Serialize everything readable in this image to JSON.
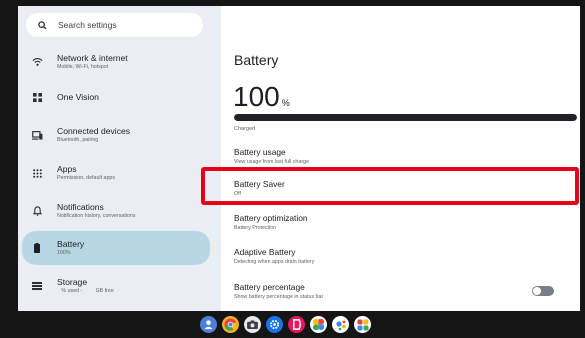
{
  "search": {
    "placeholder": "Search settings"
  },
  "sidebar": {
    "items": [
      {
        "title": "Network & internet",
        "subtitle": "Mobile, Wi-Fi, hotspot",
        "icon": "wifi-icon"
      },
      {
        "title": "One Vision",
        "subtitle": "",
        "icon": "grid-icon"
      },
      {
        "title": "Connected devices",
        "subtitle": "Bluetooth, pairing",
        "icon": "devices-icon"
      },
      {
        "title": "Apps",
        "subtitle": "Permission, default apps",
        "icon": "apps-icon"
      },
      {
        "title": "Notifications",
        "subtitle": "Notification history, conversations",
        "icon": "bell-icon"
      },
      {
        "title": "Battery",
        "subtitle": "100%",
        "icon": "battery-icon",
        "active": true
      },
      {
        "title": "Storage",
        "subtitle": "   % used -         GB free",
        "icon": "storage-icon"
      }
    ]
  },
  "main": {
    "title": "Battery",
    "percent": "100",
    "percent_unit": "%",
    "level": 1.0,
    "status": "Charged",
    "rows": [
      {
        "title": "Battery usage",
        "subtitle": "View usage from last full charge"
      },
      {
        "title": "Battery Saver",
        "subtitle": "Off"
      },
      {
        "title": "Battery optimization",
        "subtitle": "Battery Protection"
      },
      {
        "title": "Adaptive Battery",
        "subtitle": "Detecting when apps drain battery"
      },
      {
        "title": "Battery percentage",
        "subtitle": "Show battery percentage in status bar"
      }
    ],
    "battery_percentage_toggle": "off"
  },
  "colors": {
    "highlight": "#e8001b",
    "active_nav": "#b8d6e3",
    "sidebar_bg": "#eaeef2"
  },
  "dock_apps": [
    "account-icon",
    "chrome-icon",
    "camera-icon",
    "settings-icon",
    "game-icon",
    "photos-icon",
    "assistant-icon",
    "play-icon"
  ]
}
